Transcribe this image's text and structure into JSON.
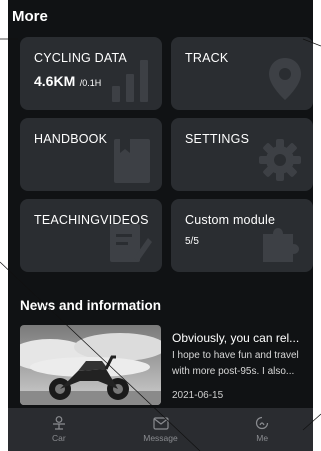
{
  "header": {
    "title": "More"
  },
  "cards": {
    "cycling": {
      "label": "CYCLING DATA",
      "value": "4.6KM",
      "unit": "/0.1H"
    },
    "track": {
      "label": "TRACK"
    },
    "handbook": {
      "label": "HANDBOOK"
    },
    "settings": {
      "label": "SETTINGS"
    },
    "videos": {
      "label": "TEACHINGVIDEOS"
    },
    "custom": {
      "label": "Custom module",
      "count": "5/5"
    }
  },
  "news": {
    "section_title": "News and information",
    "item": {
      "title": "Obviously, you can rel...",
      "body": "I hope to have fun and travel with more post-95s. I also...",
      "date": "2021-06-15"
    }
  },
  "tabbar": {
    "items": [
      {
        "label": "Car",
        "icon": "car-icon"
      },
      {
        "label": "Message",
        "icon": "message-icon"
      },
      {
        "label": "Me",
        "icon": "me-icon"
      }
    ]
  },
  "colors": {
    "background": "#101214",
    "card": "#2a2d31",
    "tabbar": "#2a2c30",
    "inactive": "#8a8c90"
  }
}
